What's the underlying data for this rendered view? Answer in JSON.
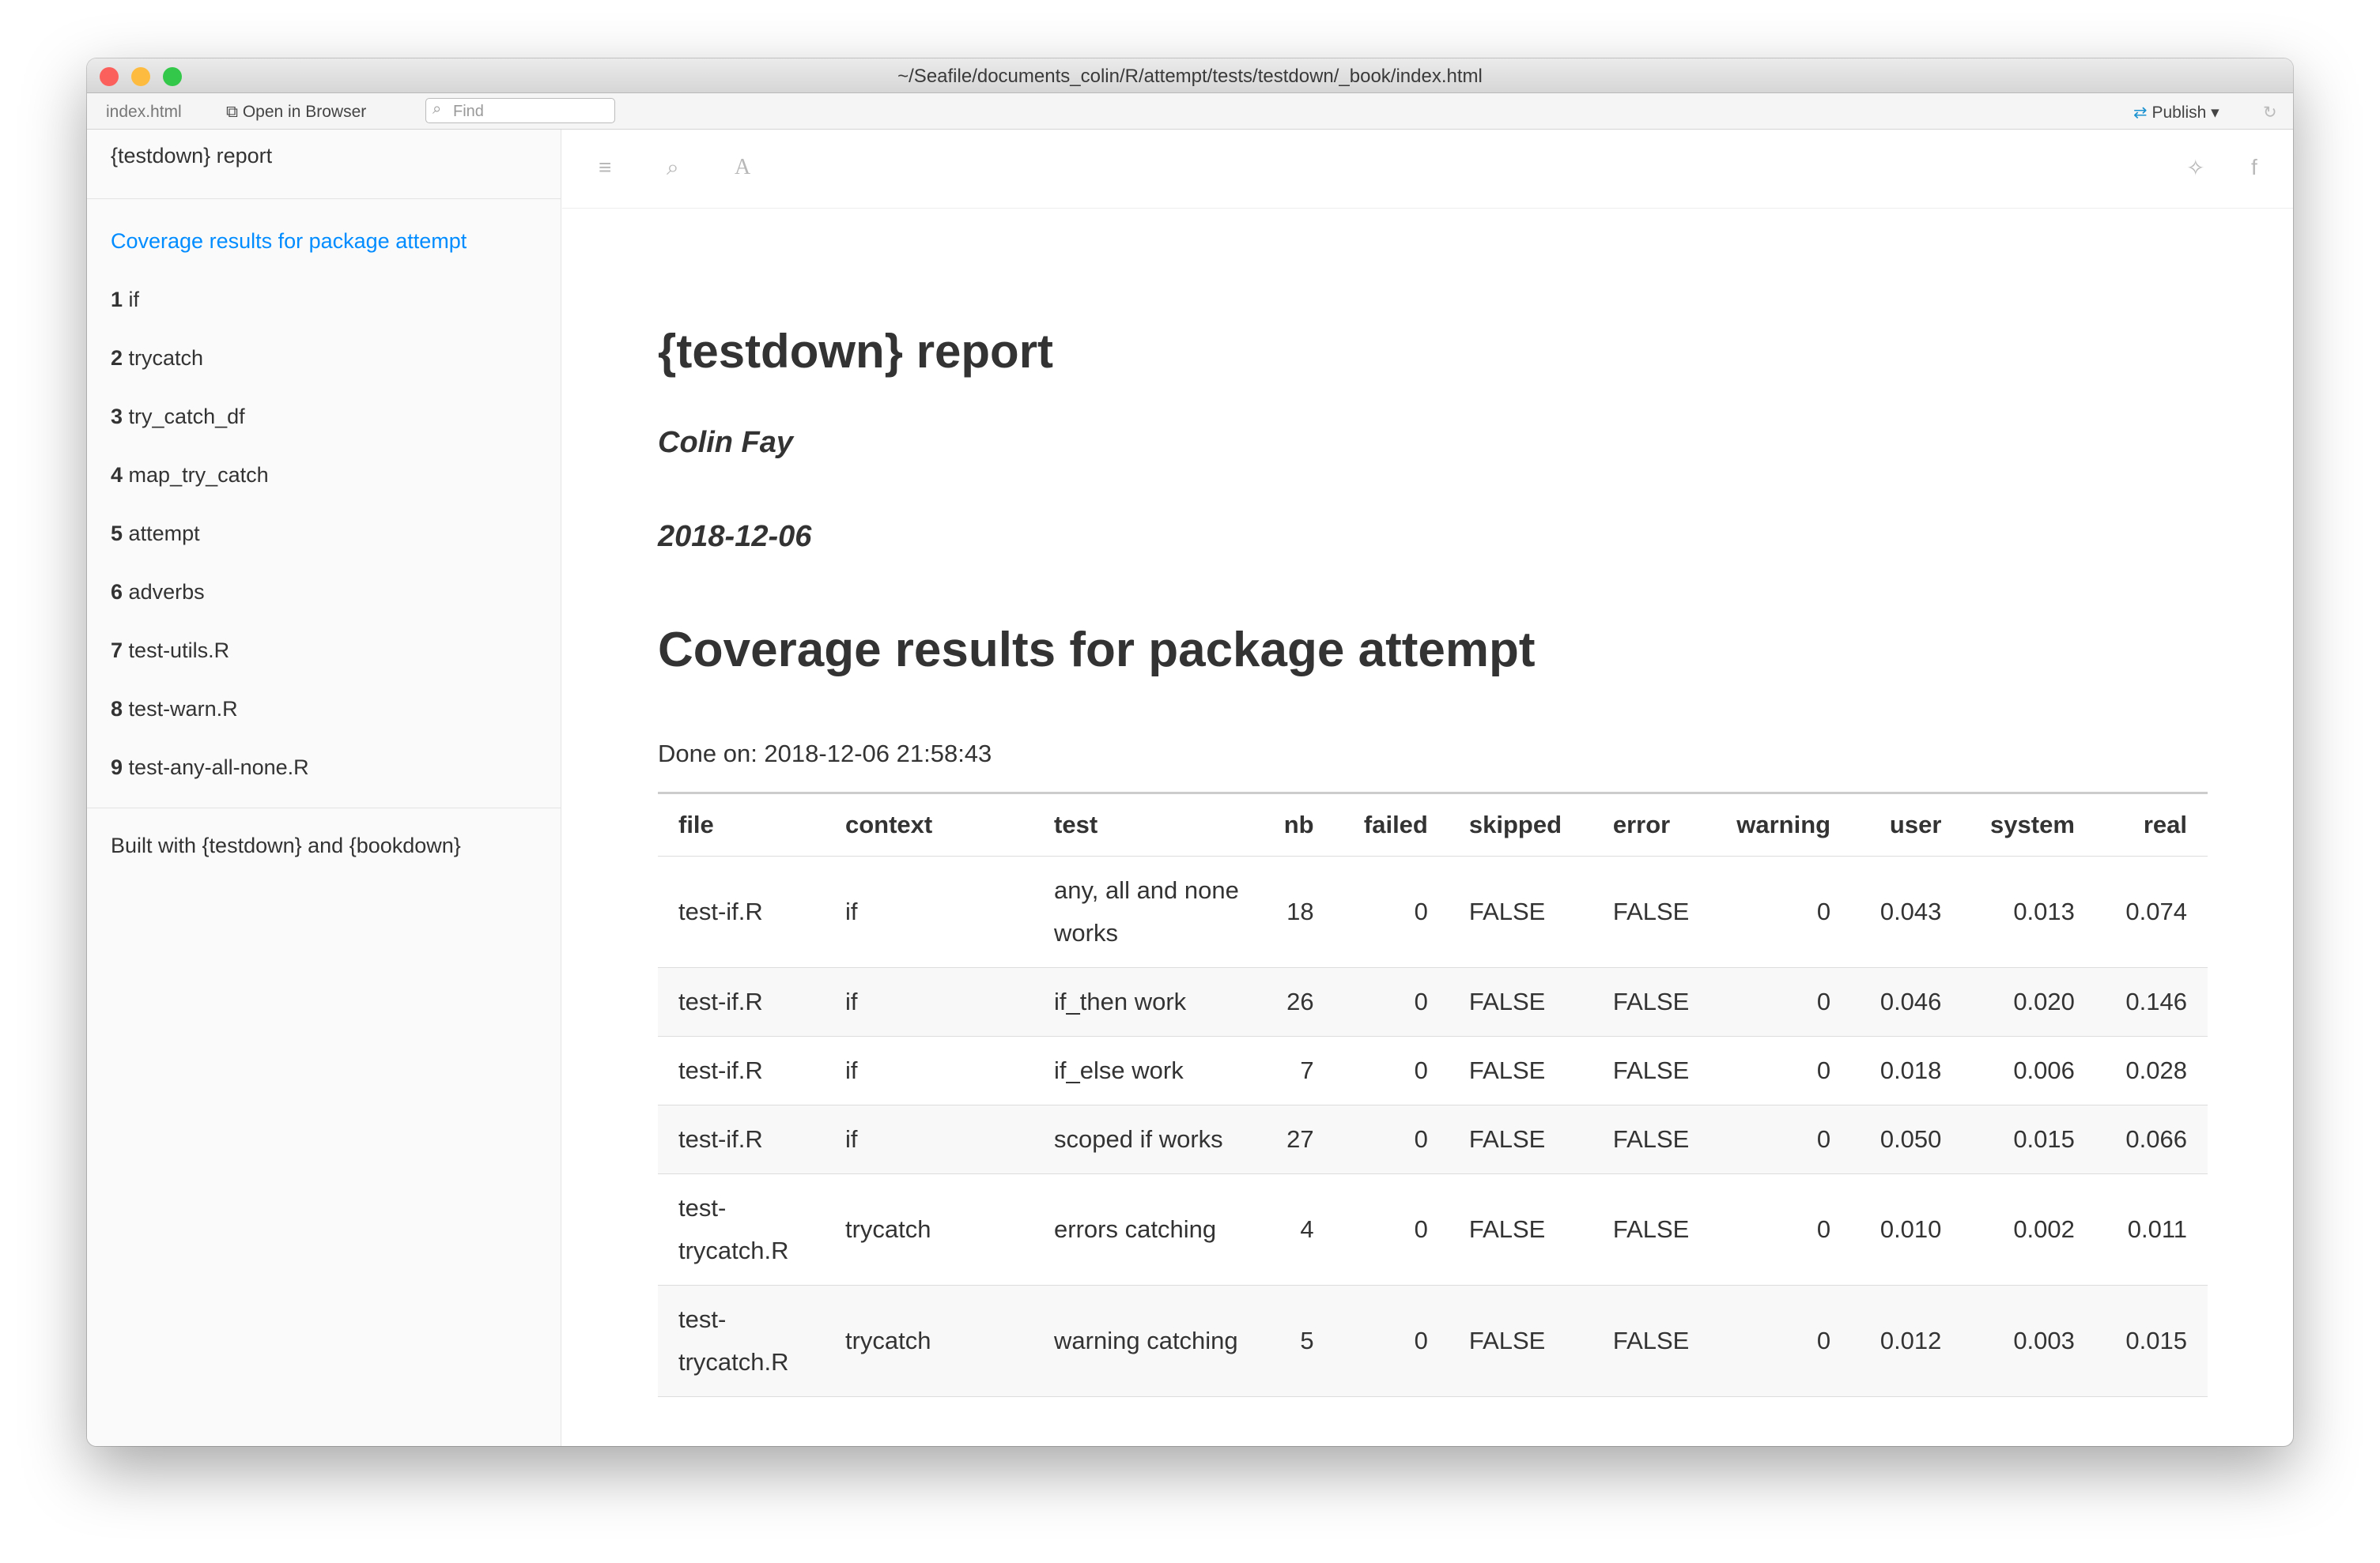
{
  "window": {
    "title": "~/Seafile/documents_colin/R/attempt/tests/testdown/_book/index.html"
  },
  "toolbar": {
    "file_tab": "index.html",
    "open_label": "Open in Browser",
    "find_placeholder": "Find",
    "publish_label": "Publish"
  },
  "sidebar": {
    "title": "{testdown} report",
    "active": "Coverage results for package attempt",
    "items": [
      {
        "num": "1",
        "label": "if"
      },
      {
        "num": "2",
        "label": "trycatch"
      },
      {
        "num": "3",
        "label": "try_catch_df"
      },
      {
        "num": "4",
        "label": "map_try_catch"
      },
      {
        "num": "5",
        "label": "attempt"
      },
      {
        "num": "6",
        "label": "adverbs"
      },
      {
        "num": "7",
        "label": "test-utils.R"
      },
      {
        "num": "8",
        "label": "test-warn.R"
      },
      {
        "num": "9",
        "label": "test-any-all-none.R"
      }
    ],
    "footer": "Built with {testdown} and {bookdown}"
  },
  "main": {
    "title": "{testdown} report",
    "author": "Colin Fay",
    "date": "2018-12-06",
    "heading": "Coverage results for package attempt",
    "done": "Done on: 2018-12-06 21:58:43"
  },
  "table": {
    "headers": [
      "file",
      "context",
      "test",
      "nb",
      "failed",
      "skipped",
      "error",
      "warning",
      "user",
      "system",
      "real"
    ],
    "rows": [
      [
        "test-if.R",
        "if",
        "any, all and none works",
        "18",
        "0",
        "FALSE",
        "FALSE",
        "0",
        "0.043",
        "0.013",
        "0.074"
      ],
      [
        "test-if.R",
        "if",
        "if_then work",
        "26",
        "0",
        "FALSE",
        "FALSE",
        "0",
        "0.046",
        "0.020",
        "0.146"
      ],
      [
        "test-if.R",
        "if",
        "if_else work",
        "7",
        "0",
        "FALSE",
        "FALSE",
        "0",
        "0.018",
        "0.006",
        "0.028"
      ],
      [
        "test-if.R",
        "if",
        "scoped if works",
        "27",
        "0",
        "FALSE",
        "FALSE",
        "0",
        "0.050",
        "0.015",
        "0.066"
      ],
      [
        "test-trycatch.R",
        "trycatch",
        "errors catching",
        "4",
        "0",
        "FALSE",
        "FALSE",
        "0",
        "0.010",
        "0.002",
        "0.011"
      ],
      [
        "test-trycatch.R",
        "trycatch",
        "warning catching",
        "5",
        "0",
        "FALSE",
        "FALSE",
        "0",
        "0.012",
        "0.003",
        "0.015"
      ]
    ]
  }
}
